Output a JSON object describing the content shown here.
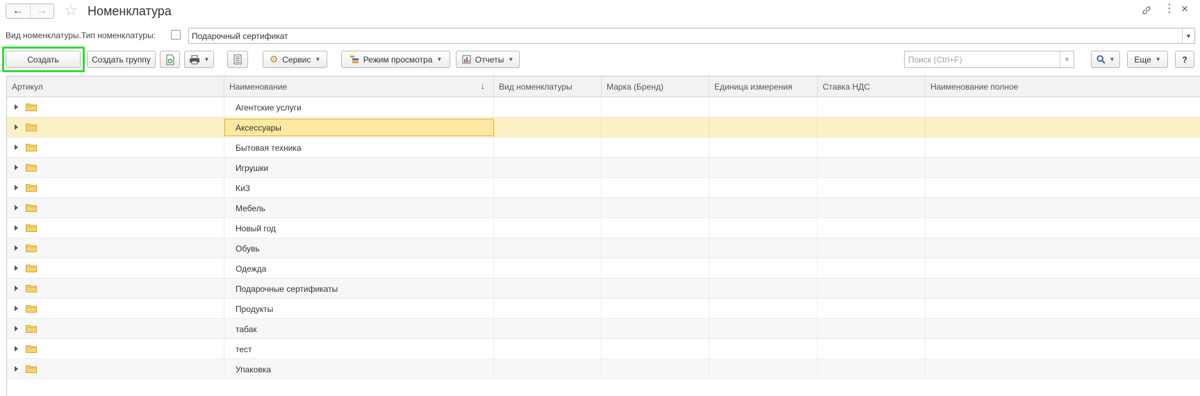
{
  "window": {
    "title": "Номенклатура"
  },
  "filter": {
    "label": "Вид номенклатуры.Тип номенклатуры:",
    "checked": false,
    "value": "Подарочный сертификат"
  },
  "toolbar": {
    "create_label": "Создать",
    "create_group_label": "Создать группу",
    "service_label": "Сервис",
    "view_mode_label": "Режим просмотра",
    "reports_label": "Отчеты",
    "search_placeholder": "Поиск (Ctrl+F)",
    "more_label": "Еще",
    "help_label": "?",
    "highlight_color": "#2fdd2f"
  },
  "table": {
    "columns": [
      "Артикул",
      "Наименование",
      "Вид номенклатуры",
      "Марка (Бренд)",
      "Единица измерения",
      "Ставка НДС",
      "Наименование полное"
    ],
    "sort_column": "Наименование",
    "sort_direction": "descending-arrow",
    "selected_row": "Аксессуары",
    "rows": [
      "Агентские услуги",
      "Аксессуары",
      "Бытовая техника",
      "Игрушки",
      "КиЗ",
      "Мебель",
      "Новый год",
      "Обувь",
      "Одежда",
      "Подарочные сертификаты",
      "Продукты",
      "табак",
      "тест",
      "Упаковка"
    ],
    "row_icon": "folder-icon",
    "selection_color": "#fcf1c6"
  }
}
